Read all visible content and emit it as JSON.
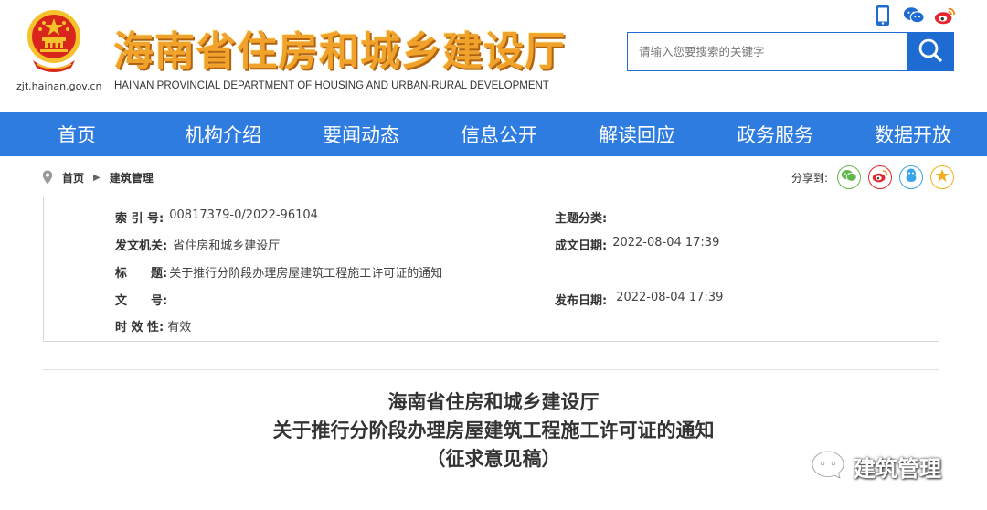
{
  "header": {
    "title": "海南省住房和城乡建设厅",
    "subtitle": "HAINAN PROVINCIAL DEPARTMENT OF HOUSING AND URBAN-RURAL DEVELOPMENT",
    "domain": "zjt.hainan.gov.cn",
    "emblem_icon": "national-emblem-icon",
    "top_icons": [
      "mobile-phone-icon",
      "wechat-icon",
      "weibo-icon"
    ],
    "search_placeholder": "请输入您要搜索的关键字",
    "search_icon": "search-icon"
  },
  "nav": {
    "items": [
      "首页",
      "机构介绍",
      "要闻动态",
      "信息公开",
      "解读回应",
      "政务服务",
      "数据开放"
    ],
    "separator": "|"
  },
  "breadcrumb": {
    "home": "首页",
    "current": "建筑管理",
    "icon": "location-pin-icon"
  },
  "share": {
    "label": "分享到:",
    "buttons": [
      "wechat-icon",
      "weibo-icon",
      "qq-icon",
      "favorite-star-icon"
    ]
  },
  "info": {
    "index_label": "索 引 号:",
    "index_value": "00817379-0/2022-96104",
    "topic_label": "主题分类:",
    "topic_value": "",
    "issuer_label": "发文机关:",
    "issuer_value": "省住房和城乡建设厅",
    "created_label": "成文日期:",
    "created_value": "2022-08-04 17:39",
    "title_label": "标　　题:",
    "title_value": "关于推行分阶段办理房屋建筑工程施工许可证的通知",
    "docno_label": "文　　号:",
    "docno_value": "",
    "published_label": "发布日期:",
    "published_value": "2022-08-04 17:39",
    "validity_label": "时 效 性:",
    "validity_value": "有效"
  },
  "article": {
    "line1": "海南省住房和城乡建设厅",
    "line2": "关于推行分阶段办理房屋建筑工程施工许可证的通知",
    "line3": "（征求意见稿）"
  },
  "watermark": {
    "text": "建筑管理",
    "icon": "wechat-official-account-icon"
  },
  "colors": {
    "nav_bg": "#2e7ce0",
    "search_blue": "#1e6cd1",
    "title_gold": "#f0a22b",
    "emblem_red": "#d8261c",
    "emblem_gold": "#f5c22b"
  }
}
